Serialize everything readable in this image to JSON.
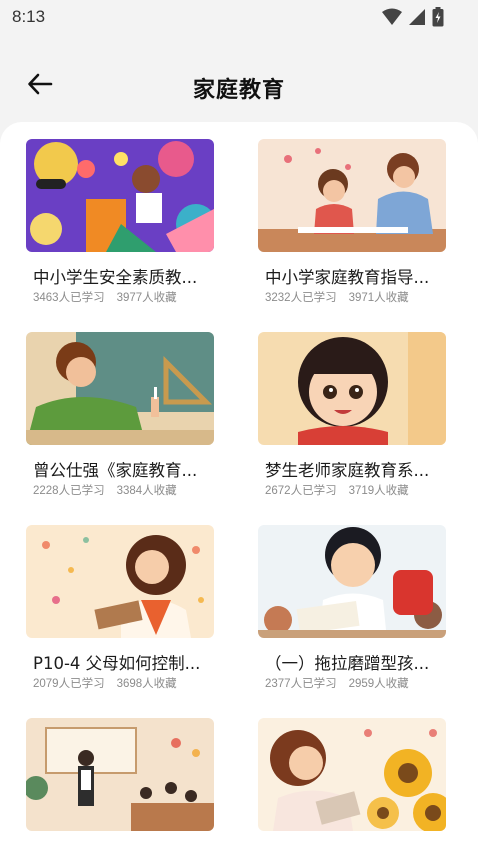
{
  "status_bar": {
    "time": "8:13",
    "icons": [
      "wifi-icon",
      "signal-icon",
      "battery-icon"
    ]
  },
  "header": {
    "back_icon": "arrow-left-icon",
    "title": "家庭教育"
  },
  "courses": [
    {
      "title": "中小学生安全素质教...",
      "learners": "3463人已学习",
      "favorites": "3977人收藏",
      "thumb": "children-playing-illustration"
    },
    {
      "title": "中小学家庭教育指导...",
      "learners": "3232人已学习",
      "favorites": "3971人收藏",
      "thumb": "mother-and-son-illustration"
    },
    {
      "title": "曾公仕强《家庭教育...",
      "learners": "2228人已学习",
      "favorites": "3384人收藏",
      "thumb": "teacher-at-blackboard-illustration"
    },
    {
      "title": "梦生老师家庭教育系...",
      "learners": "2672人已学习",
      "favorites": "3719人收藏",
      "thumb": "smiling-girl-illustration"
    },
    {
      "title": "P10-4  父母如何控制...",
      "learners": "2079人已学习",
      "favorites": "3698人收藏",
      "thumb": "woman-with-book-illustration"
    },
    {
      "title": "（一）拖拉磨蹭型孩...",
      "learners": "2377人已学习",
      "favorites": "2959人收藏",
      "thumb": "boy-writing-illustration"
    },
    {
      "title": "",
      "learners": "",
      "favorites": "",
      "thumb": "classroom-illustration"
    },
    {
      "title": "",
      "learners": "",
      "favorites": "",
      "thumb": "woman-with-sunflowers-illustration"
    }
  ]
}
